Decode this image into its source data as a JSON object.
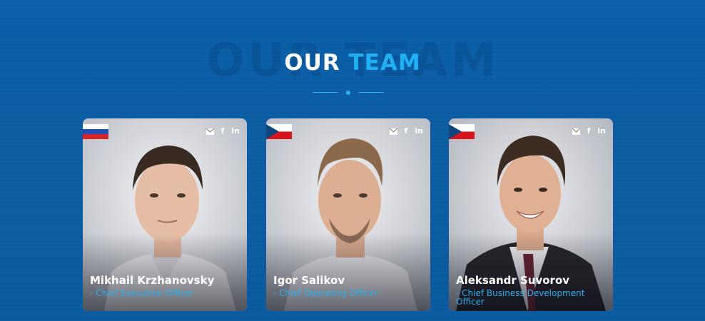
{
  "section": {
    "ghost_text": "OUR TEAM",
    "title_part1": "OUR",
    "title_part2": "TEAM"
  },
  "members": [
    {
      "name": "Mikhail Krzhanovsky",
      "role": "- Chief Executive Officer",
      "flag": "russia-flag"
    },
    {
      "name": "Igor Salikov",
      "role": "- Chief Operating Officer",
      "flag": "czech-flag"
    },
    {
      "name": "Aleksandr Suvorov",
      "role": "- Chief Business Development Officer",
      "flag": "czech-flag"
    }
  ],
  "socials": [
    "email-icon",
    "facebook-icon",
    "linkedin-icon"
  ],
  "colors": {
    "accent": "#22b0f5",
    "background": "#0a5ca3"
  }
}
